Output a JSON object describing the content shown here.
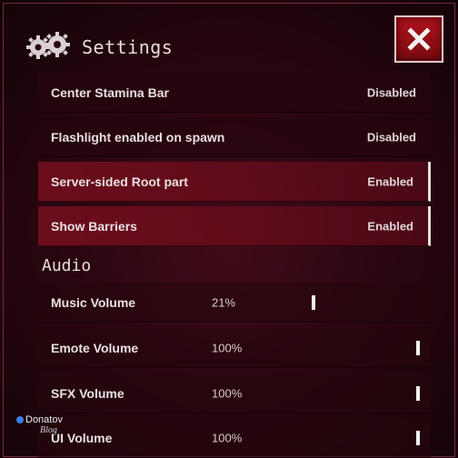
{
  "header": {
    "title": "Settings",
    "icon": "gears-icon",
    "close_icon": "close-icon",
    "accent_color": "#b2121c"
  },
  "toggles": [
    {
      "label": "Center Stamina Bar",
      "value": "Disabled",
      "active": false
    },
    {
      "label": "Flashlight enabled on spawn",
      "value": "Disabled",
      "active": false
    },
    {
      "label": "Server-sided Root part",
      "value": "Enabled",
      "active": true
    },
    {
      "label": "Show Barriers",
      "value": "Enabled",
      "active": true
    }
  ],
  "audio": {
    "section_title": "Audio",
    "sliders": [
      {
        "label": "Music Volume",
        "value_text": "21%",
        "value": 0.21
      },
      {
        "label": "Emote Volume",
        "value_text": "100%",
        "value": 1.0
      },
      {
        "label": "SFX Volume",
        "value_text": "100%",
        "value": 1.0
      },
      {
        "label": "UI Volume",
        "value_text": "100%",
        "value": 1.0
      }
    ]
  },
  "watermark": {
    "name": "Donatov",
    "sub": "Blog"
  }
}
